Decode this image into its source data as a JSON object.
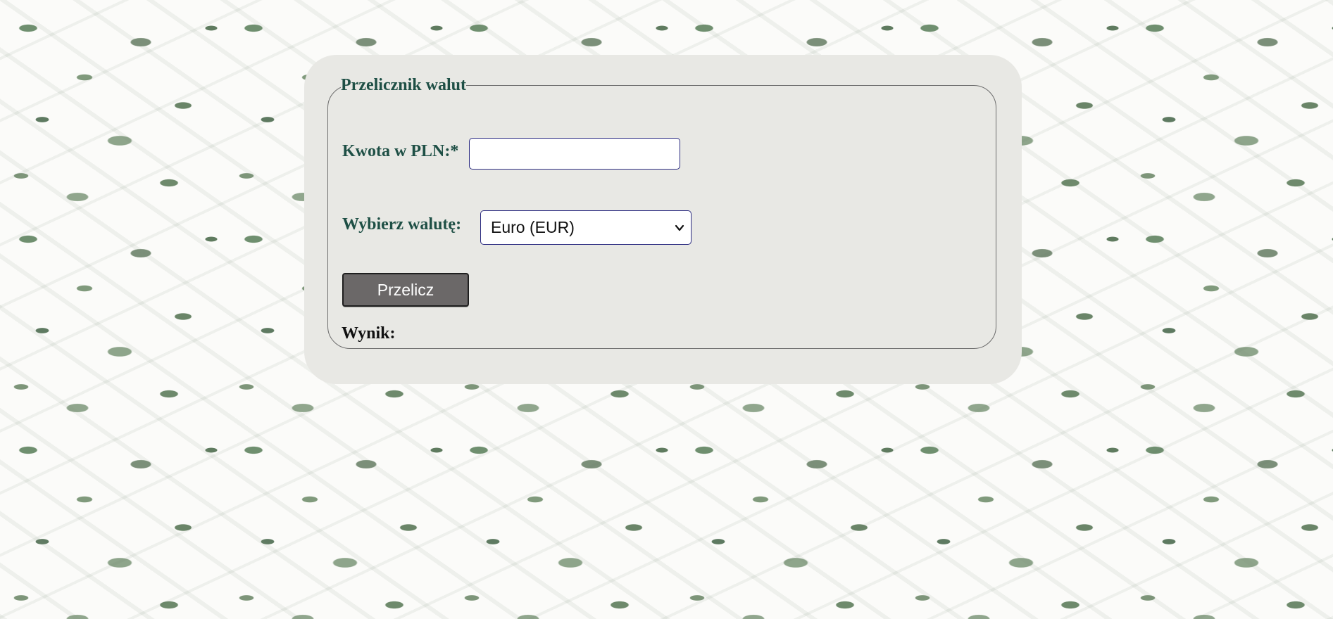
{
  "converter": {
    "title": "Przelicznik walut",
    "amount_label": "Kwota w PLN:*",
    "amount_value": "",
    "currency_label": "Wybierz walutę:",
    "currency_selected": "Euro (EUR)",
    "convert_button_label": "Przelicz",
    "result_label": "Wynik:"
  },
  "colors": {
    "label_green": "#1e4f45",
    "panel_background": "#e8e8e4",
    "button_background": "#6b6868",
    "input_border": "#2a2a80"
  },
  "icons": {
    "select_arrow": "chevron-down-icon"
  }
}
